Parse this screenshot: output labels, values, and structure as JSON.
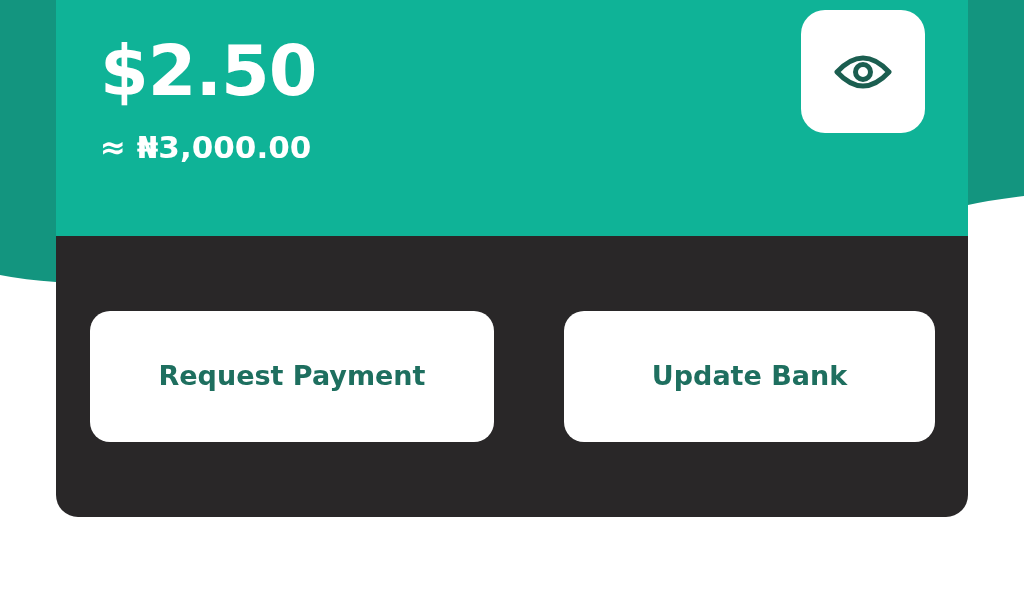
{
  "balance": {
    "amount": "$2.50",
    "converted": "≈ ₦3,000.00"
  },
  "actions": [
    {
      "label": "Request Payment"
    },
    {
      "label": "Update Bank"
    }
  ]
}
